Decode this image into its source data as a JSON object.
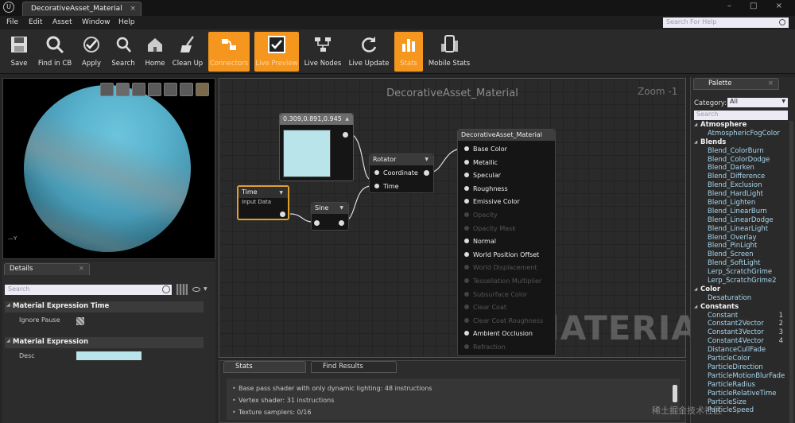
{
  "window": {
    "tab_title": "DecorativeAsset_Material",
    "tab_close": "×",
    "buttons": "– □ ×"
  },
  "menu": [
    "File",
    "Edit",
    "Asset",
    "Window",
    "Help"
  ],
  "help_search_placeholder": "Search For Help",
  "toolbar": [
    {
      "label": "Save",
      "icon": "save-icon",
      "active": false
    },
    {
      "label": "Find in CB",
      "icon": "find-icon",
      "active": false
    },
    {
      "label": "Apply",
      "icon": "apply-icon",
      "active": false
    },
    {
      "label": "Search",
      "icon": "search-icon",
      "active": false
    },
    {
      "label": "Home",
      "icon": "home-icon",
      "active": false
    },
    {
      "label": "Clean Up",
      "icon": "broom-icon",
      "active": false
    },
    {
      "label": "Connectors",
      "icon": "connectors-icon",
      "active": true
    },
    {
      "label": "Live Preview",
      "icon": "checkbox-icon",
      "active": true
    },
    {
      "label": "Live Nodes",
      "icon": "nodes-icon",
      "active": false
    },
    {
      "label": "Live Update",
      "icon": "refresh-icon",
      "active": false
    },
    {
      "label": "Stats",
      "icon": "stats-icon",
      "active": true
    },
    {
      "label": "Mobile Stats",
      "icon": "mobile-icon",
      "active": false
    }
  ],
  "viewport": {
    "axis_label": "Y"
  },
  "details": {
    "tab": "Details",
    "tab_close": "×",
    "search_placeholder": "Search",
    "sections": [
      {
        "title": "Material Expression Time",
        "property": "Ignore Pause"
      },
      {
        "title": "Material Expression",
        "property": "Desc"
      }
    ]
  },
  "graph": {
    "title": "DecorativeAsset_Material",
    "zoom": "Zoom -1",
    "watermark": "MATERIAL",
    "nodes": {
      "constant": {
        "title": "0.309,0.891,0.945",
        "color": "#b8e4ea"
      },
      "time": {
        "title": "Time",
        "subtitle": "Input Data"
      },
      "sine": {
        "title": "Sine"
      },
      "rotator": {
        "title": "Rotator",
        "inputs": [
          "Coordinate",
          "Time"
        ]
      },
      "material": {
        "title": "DecorativeAsset_Material",
        "inputs": [
          {
            "label": "Base Color",
            "enabled": true
          },
          {
            "label": "Metallic",
            "enabled": true
          },
          {
            "label": "Specular",
            "enabled": true
          },
          {
            "label": "Roughness",
            "enabled": true
          },
          {
            "label": "Emissive Color",
            "enabled": true
          },
          {
            "label": "Opacity",
            "enabled": false
          },
          {
            "label": "Opacity Mask",
            "enabled": false
          },
          {
            "label": "Normal",
            "enabled": true
          },
          {
            "label": "World Position Offset",
            "enabled": true
          },
          {
            "label": "World Displacement",
            "enabled": false
          },
          {
            "label": "Tessellation Multiplier",
            "enabled": false
          },
          {
            "label": "Subsurface Color",
            "enabled": false
          },
          {
            "label": "Clear Coat",
            "enabled": false
          },
          {
            "label": "Clear Coat Roughness",
            "enabled": false
          },
          {
            "label": "Ambient Occlusion",
            "enabled": true
          },
          {
            "label": "Refraction",
            "enabled": false
          }
        ]
      }
    }
  },
  "bottom": {
    "tabs": [
      "Stats",
      "Find Results"
    ],
    "stats": [
      "Base pass shader with only dynamic lighting: 48 instructions",
      "Vertex shader: 31 instructions",
      "Texture samplers: 0/16"
    ]
  },
  "palette": {
    "tab": "Palette",
    "tab_close": "×",
    "category_label": "Category:",
    "category_value": "All",
    "search_placeholder": "Search",
    "entries": [
      {
        "type": "cat",
        "label": "Atmosphere"
      },
      {
        "type": "item",
        "label": "AtmosphericFogColor"
      },
      {
        "type": "cat",
        "label": "Blends"
      },
      {
        "type": "item",
        "label": "Blend_ColorBurn"
      },
      {
        "type": "item",
        "label": "Blend_ColorDodge"
      },
      {
        "type": "item",
        "label": "Blend_Darken"
      },
      {
        "type": "item",
        "label": "Blend_Difference"
      },
      {
        "type": "item",
        "label": "Blend_Exclusion"
      },
      {
        "type": "item",
        "label": "Blend_HardLight"
      },
      {
        "type": "item",
        "label": "Blend_Lighten"
      },
      {
        "type": "item",
        "label": "Blend_LinearBurn"
      },
      {
        "type": "item",
        "label": "Blend_LinearDodge"
      },
      {
        "type": "item",
        "label": "Blend_LinearLight"
      },
      {
        "type": "item",
        "label": "Blend_Overlay"
      },
      {
        "type": "item",
        "label": "Blend_PinLight"
      },
      {
        "type": "item",
        "label": "Blend_Screen"
      },
      {
        "type": "item",
        "label": "Blend_SoftLight"
      },
      {
        "type": "item",
        "label": "Lerp_ScratchGrime"
      },
      {
        "type": "item",
        "label": "Lerp_ScratchGrime2"
      },
      {
        "type": "cat",
        "label": "Color"
      },
      {
        "type": "item",
        "label": "Desaturation"
      },
      {
        "type": "cat",
        "label": "Constants"
      },
      {
        "type": "item",
        "label": "Constant",
        "num": "1"
      },
      {
        "type": "item",
        "label": "Constant2Vector",
        "num": "2"
      },
      {
        "type": "item",
        "label": "Constant3Vector",
        "num": "3"
      },
      {
        "type": "item",
        "label": "Constant4Vector",
        "num": "4"
      },
      {
        "type": "item",
        "label": "DistanceCullFade"
      },
      {
        "type": "item",
        "label": "ParticleColor"
      },
      {
        "type": "item",
        "label": "ParticleDirection"
      },
      {
        "type": "item",
        "label": "ParticleMotionBlurFade"
      },
      {
        "type": "item",
        "label": "ParticleRadius"
      },
      {
        "type": "item",
        "label": "ParticleRelativeTime"
      },
      {
        "type": "item",
        "label": "ParticleSize"
      },
      {
        "type": "item",
        "label": "ParticleSpeed"
      }
    ]
  },
  "overlay_text": "稀土掘金技术社区",
  "colors": {
    "accent": "#f5961e",
    "node_header": "#3a3a3a",
    "constant_swatch": "#b8e4ea",
    "palette_item": "#a8d8f0"
  }
}
